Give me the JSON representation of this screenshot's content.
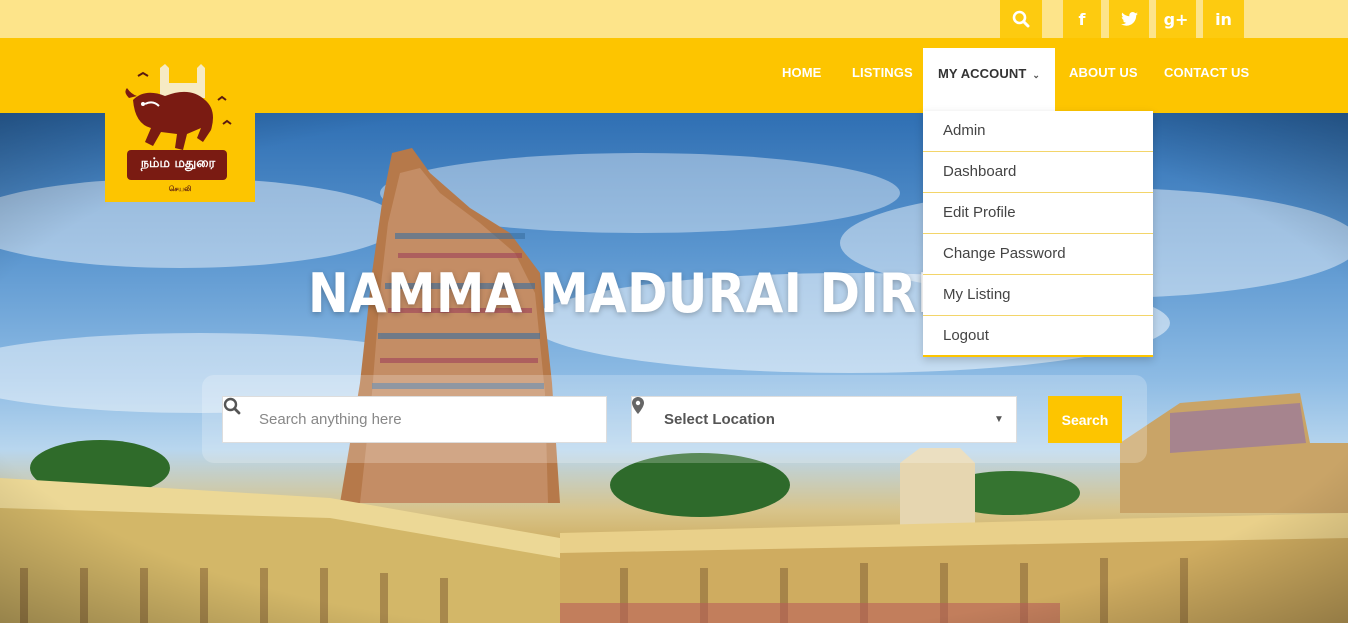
{
  "topbar": {
    "icons": [
      "search-icon",
      "facebook-icon",
      "twitter-icon",
      "google-plus-icon",
      "linkedin-icon"
    ],
    "facebook_glyph": "f",
    "googleplus_glyph": "g+",
    "linkedin_glyph": "in"
  },
  "logo": {
    "text_main": "நம்ம மதுரை",
    "text_sub": "செயலி"
  },
  "nav": {
    "home": "HOME",
    "listings": "LISTINGS",
    "my_account": "MY ACCOUNT",
    "about": "ABOUT US",
    "contact": "CONTACT US"
  },
  "dropdown": {
    "items": [
      "Admin",
      "Dashboard",
      "Edit Profile",
      "Change Password",
      "My Listing",
      "Logout"
    ]
  },
  "hero": {
    "title": "NAMMA MADURAI DIRECT"
  },
  "search": {
    "placeholder": "Search anything here",
    "location_value": "Select Location",
    "button_label": "Search"
  },
  "colors": {
    "accent": "#fdc500",
    "topbar": "#fde48a"
  }
}
